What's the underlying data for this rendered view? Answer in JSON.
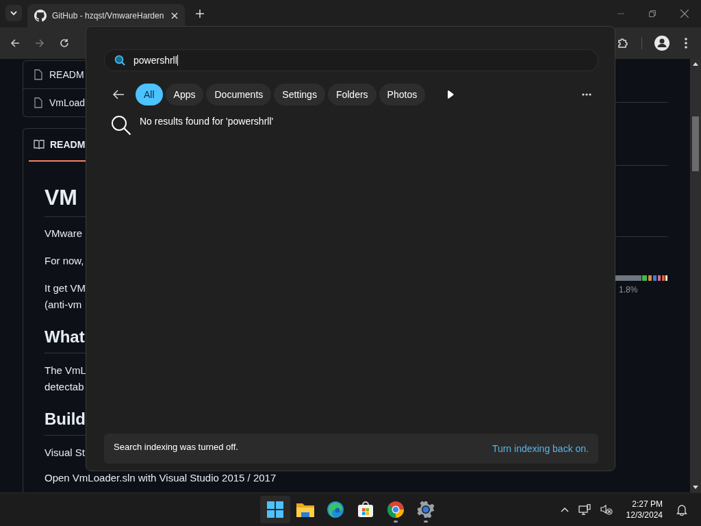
{
  "browser": {
    "tab_title": "GitHub - hzqst/VmwareHarden"
  },
  "files": [
    "READM",
    "VmLoad"
  ],
  "readme": {
    "tab": "READM",
    "blocks": [
      {
        "kind": "h1",
        "text": "VM"
      },
      {
        "kind": "p",
        "text": "VMware"
      },
      {
        "kind": "p",
        "text": "For now,"
      },
      {
        "kind": "p",
        "text": "It get VM\n(anti-vm"
      },
      {
        "kind": "h2",
        "text": "What"
      },
      {
        "kind": "p",
        "text": "The VmL\ndetectab"
      },
      {
        "kind": "h2",
        "text": "Build"
      },
      {
        "kind": "p",
        "text": "Visual St"
      },
      {
        "kind": "p",
        "text": "Open VmLoader.sln with Visual Studio 2015 / 2017"
      }
    ]
  },
  "languages": {
    "percent": "1.8%"
  },
  "search": {
    "query": "powershrll",
    "filters": [
      {
        "label": "All",
        "selected": true
      },
      {
        "label": "Apps",
        "selected": false
      },
      {
        "label": "Documents",
        "selected": false
      },
      {
        "label": "Settings",
        "selected": false
      },
      {
        "label": "Folders",
        "selected": false
      },
      {
        "label": "Photos",
        "selected": false
      }
    ],
    "message": "No results found for 'powershrll'",
    "notice": "Search indexing was turned off.",
    "notice_link": "Turn indexing back on."
  },
  "taskbar": {
    "apps": [
      {
        "kind": "start",
        "running": false
      },
      {
        "kind": "explorer",
        "running": false
      },
      {
        "kind": "edge",
        "running": false
      },
      {
        "kind": "store",
        "running": false
      },
      {
        "kind": "chrome",
        "running": true
      },
      {
        "kind": "settings",
        "running": true
      }
    ],
    "time": "2:27 PM",
    "date": "12/3/2024"
  }
}
